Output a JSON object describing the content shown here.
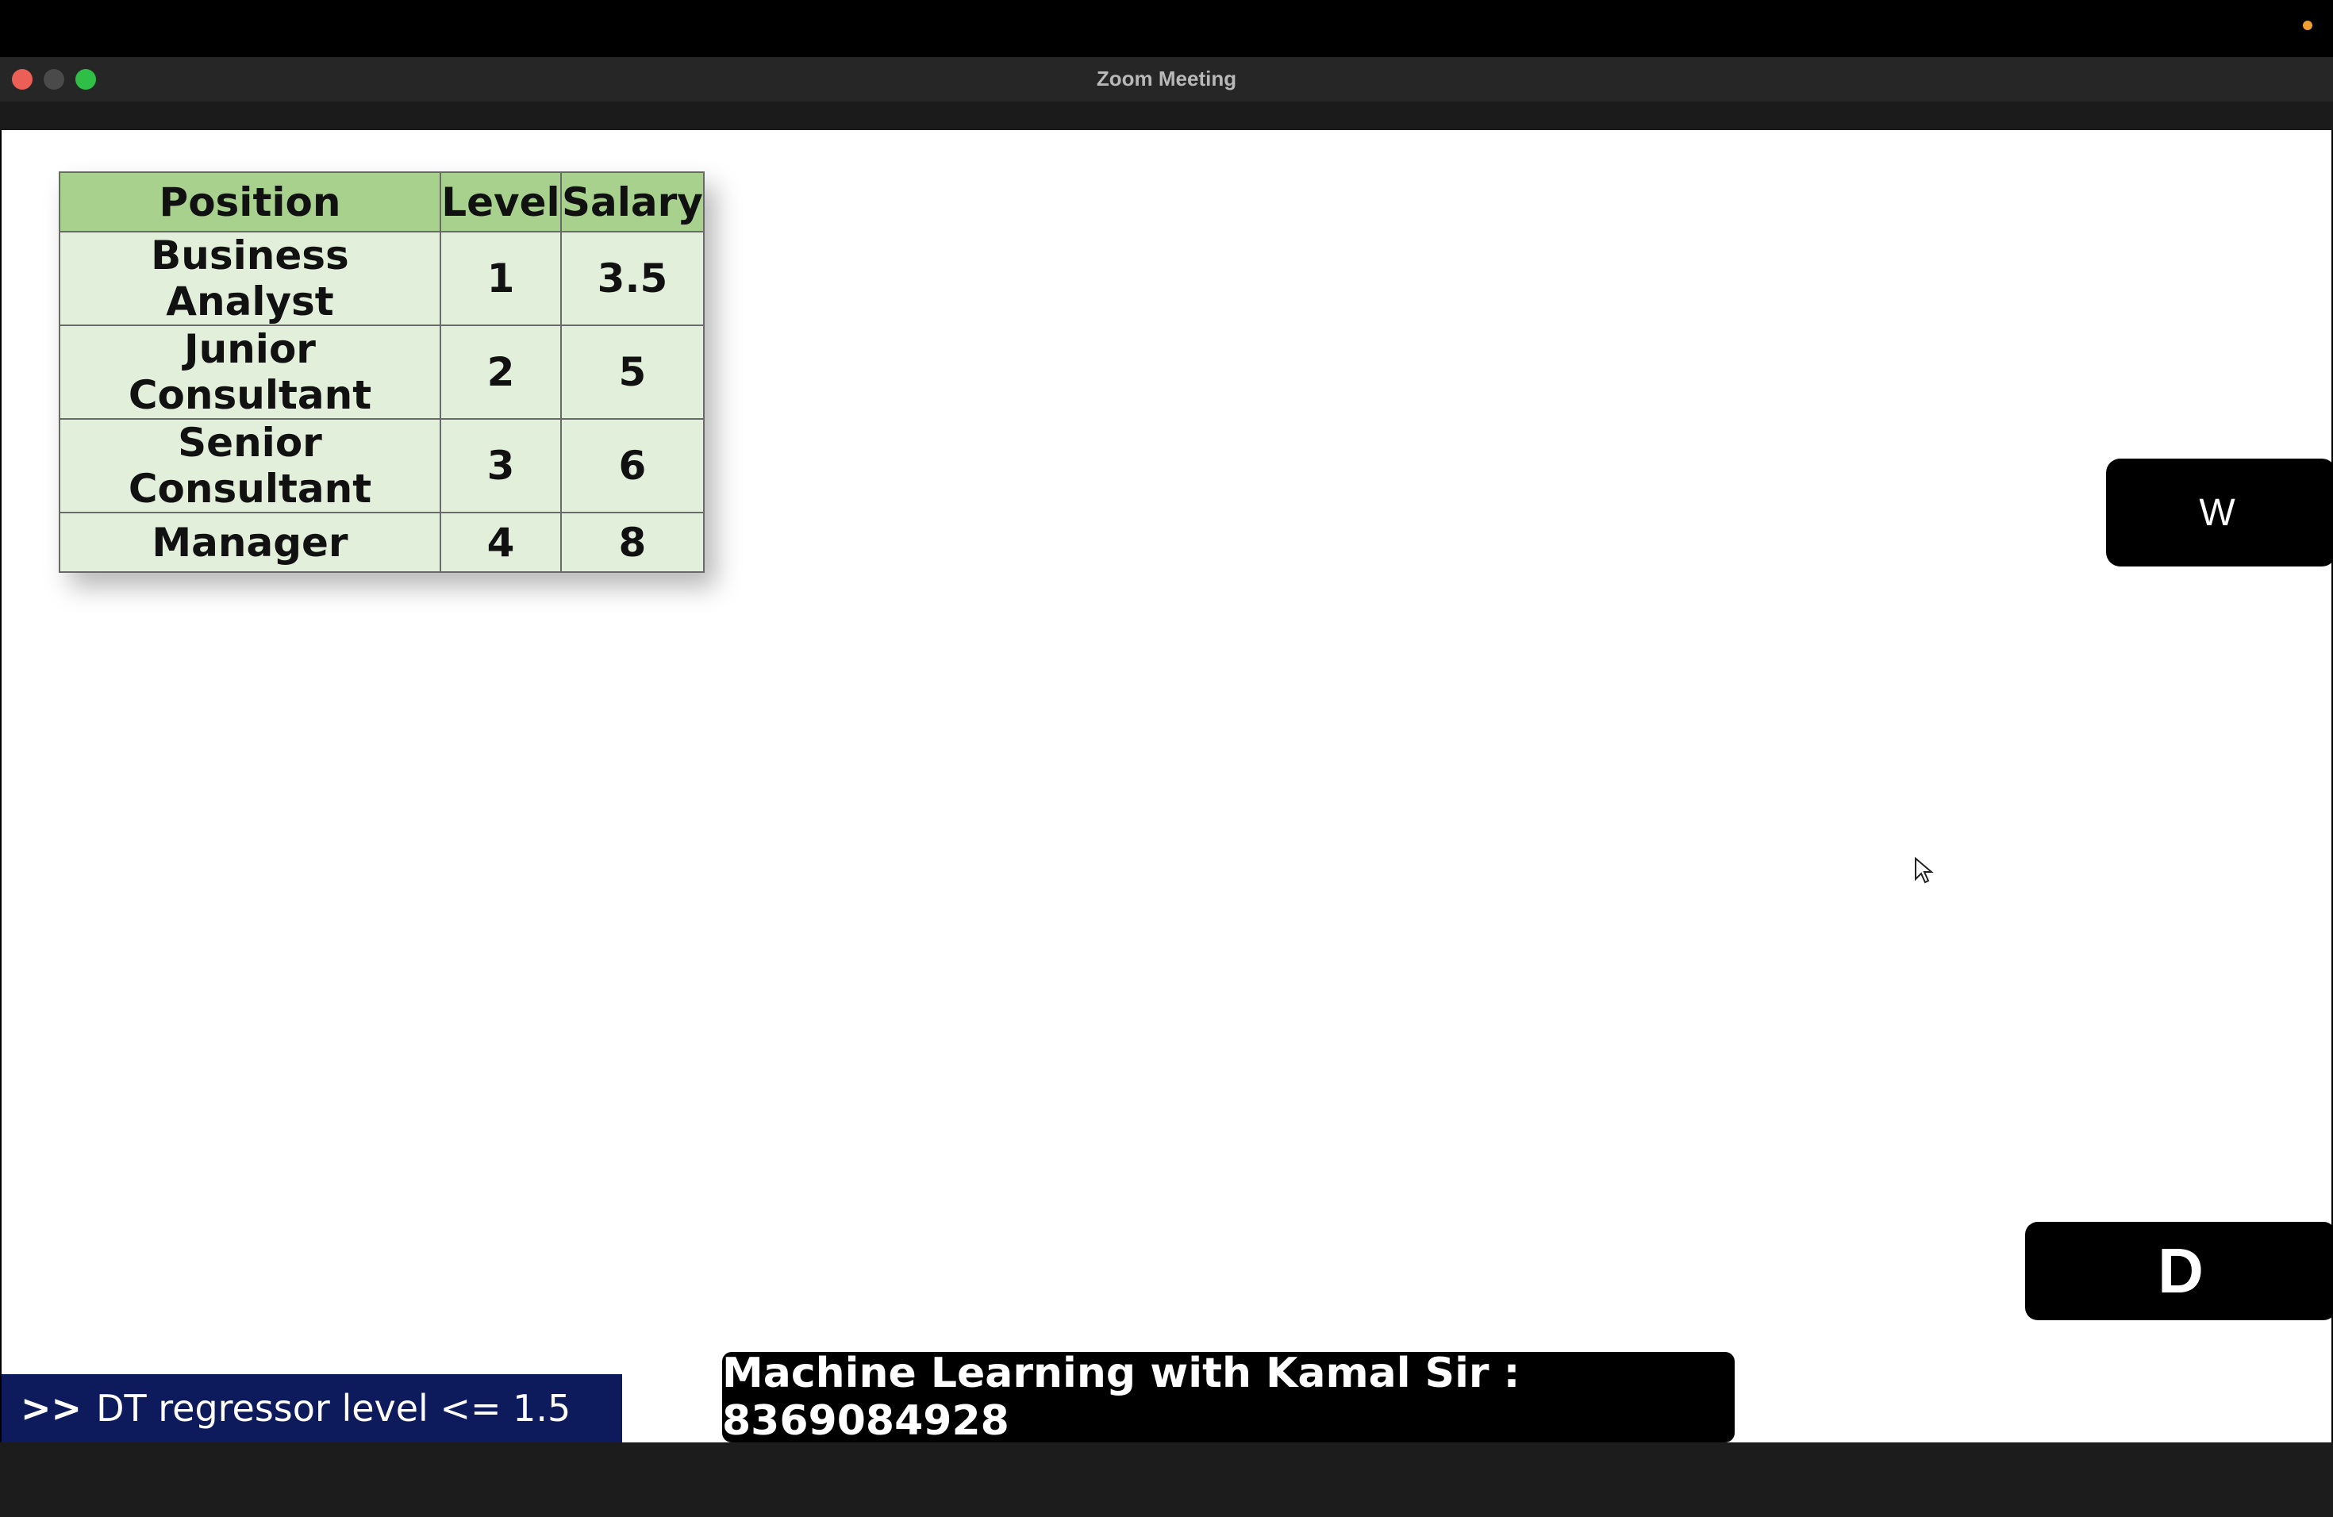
{
  "window": {
    "title": "Zoom Meeting"
  },
  "table": {
    "headers": [
      "Position",
      "Level",
      "Salary"
    ],
    "rows": [
      [
        "Business Analyst",
        "1",
        "3.5"
      ],
      [
        "Junior Consultant",
        "2",
        "5"
      ],
      [
        "Senior Consultant",
        "3",
        "6"
      ],
      [
        "Manager",
        "4",
        "8"
      ]
    ]
  },
  "tiles": {
    "participant_w": "W",
    "participant_d": "D"
  },
  "banner": {
    "text": "Machine Learning with Kamal Sir : 8369084928"
  },
  "terminal": {
    "prompt": ">>",
    "text": "DT regressor level <= 1.5"
  },
  "colors": {
    "header_green": "#a8d18d",
    "cell_green": "#e2efda",
    "terminal_blue": "#0d1a5c"
  }
}
